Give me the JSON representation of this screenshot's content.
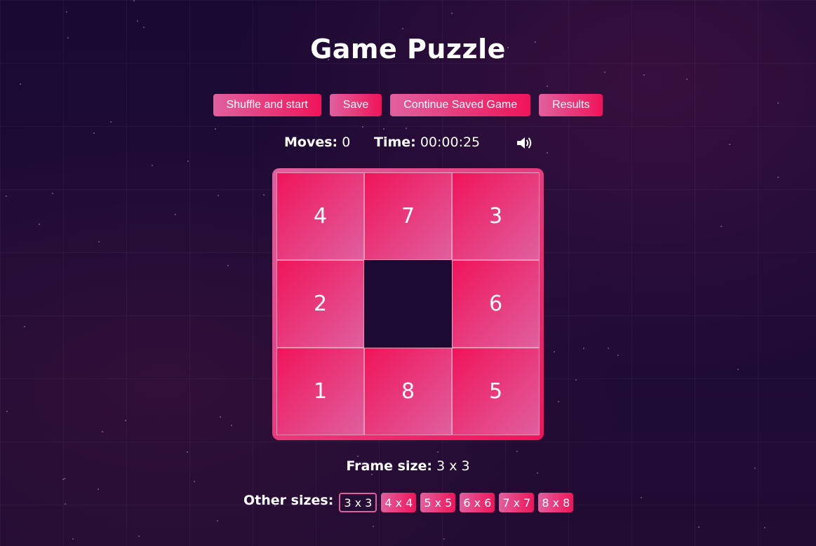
{
  "title": "Game Puzzle",
  "controls": {
    "shuffle_label": "Shuffle and start",
    "save_label": "Save",
    "continue_label": "Continue Saved Game",
    "results_label": "Results"
  },
  "stats": {
    "moves_label": "Moves:",
    "moves_value": "0",
    "time_label": "Time:",
    "time_value": "00:00:25",
    "sound_icon": "speaker-volume-icon"
  },
  "board": {
    "size": 3,
    "tiles": [
      [
        "4",
        "7",
        "3"
      ],
      [
        "2",
        "",
        "6"
      ],
      [
        "1",
        "8",
        "5"
      ]
    ]
  },
  "frame_size": {
    "label": "Frame size:",
    "value": "3 x 3"
  },
  "other_sizes": {
    "label": "Other sizes:",
    "options": [
      "3 x 3",
      "4 x 4",
      "5 x 5",
      "6 x 6",
      "7 x 7",
      "8 x 8"
    ],
    "selected": "3 x 3"
  },
  "colors": {
    "accent_start": "#e0609e",
    "accent_end": "#f0145a",
    "background": "#1d0b35"
  }
}
